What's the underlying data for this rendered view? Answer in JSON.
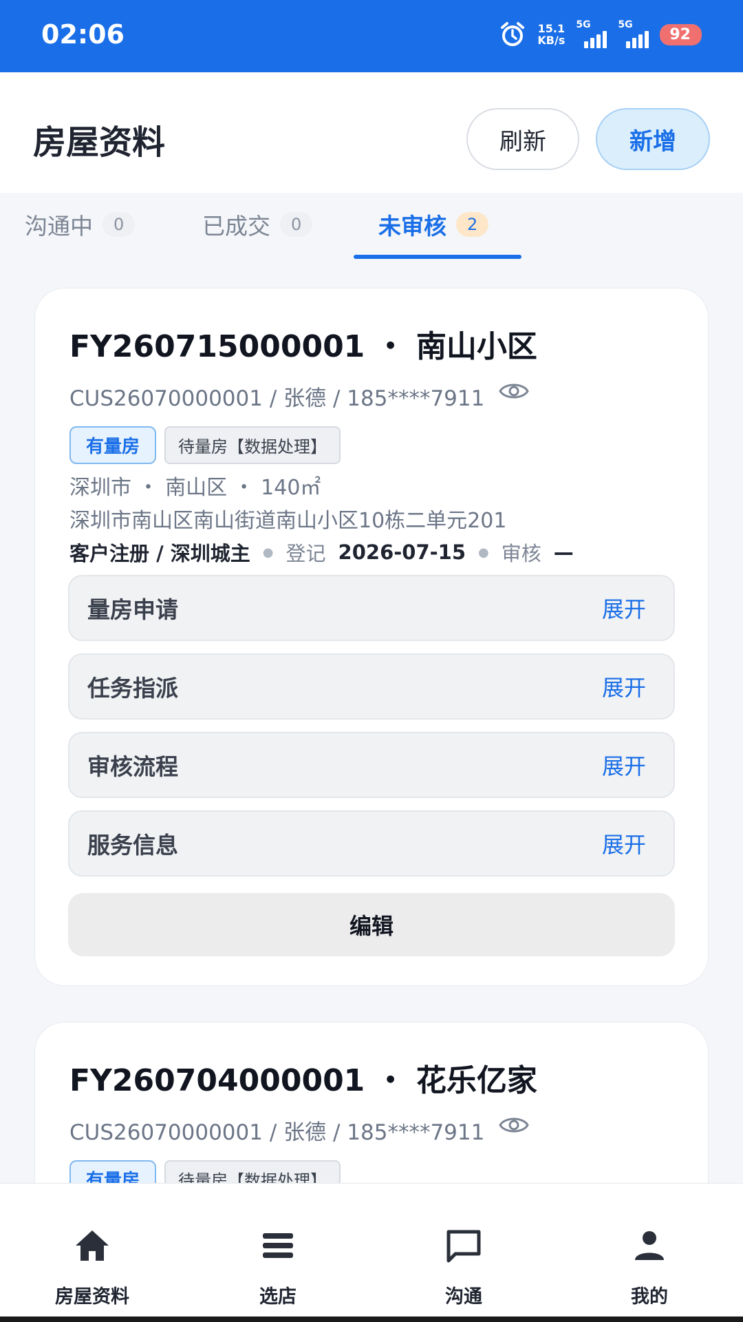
{
  "status_bar": {
    "time": "02:06",
    "speed_value": "15.1",
    "speed_unit": "KB/s",
    "network1": "5G",
    "network2": "5G",
    "battery": "92"
  },
  "header": {
    "title": "房屋资料",
    "refresh_label": "刷新",
    "add_label": "新增"
  },
  "tabs": [
    {
      "label": "沟通中",
      "count": "0",
      "active": false
    },
    {
      "label": "已成交",
      "count": "0",
      "active": false
    },
    {
      "label": "未审核",
      "count": "2",
      "active": true
    }
  ],
  "cards": [
    {
      "title": "FY260715000001 ・ 南山小区",
      "subtitle": "CUS26070000001 / 张德 / 185****7911",
      "tag_primary": "有量房",
      "tag_secondary": "待量房【数据处理】",
      "location": "深圳市 ・ 南山区 ・ 140㎡",
      "address": "深圳市南山区南山街道南山小区10栋二单元201",
      "source": "客户注册 / 深圳城主",
      "register_label": "登记",
      "register_date": "2026-07-15",
      "audit_label": "审核",
      "audit_value": "—",
      "sections": [
        {
          "title": "量房申请",
          "action": "展开"
        },
        {
          "title": "任务指派",
          "action": "展开"
        },
        {
          "title": "审核流程",
          "action": "展开"
        },
        {
          "title": "服务信息",
          "action": "展开"
        }
      ],
      "edit_label": "编辑"
    },
    {
      "title": "FY260704000001 ・ 花乐亿家",
      "subtitle": "CUS26070000001 / 张德 / 185****7911",
      "tag_primary": "有量房",
      "tag_secondary": "待量房【数据处理】"
    }
  ],
  "bottom_nav": [
    {
      "label": "房屋资料",
      "icon": "home-icon"
    },
    {
      "label": "选店",
      "icon": "store-icon"
    },
    {
      "label": "沟通",
      "icon": "chat-icon"
    },
    {
      "label": "我的",
      "icon": "person-icon"
    }
  ],
  "colors": {
    "accent": "#1a6fe8",
    "status_bar": "#1a6fe8",
    "badge_active": "#fde7c8",
    "battery": "#f07070"
  }
}
